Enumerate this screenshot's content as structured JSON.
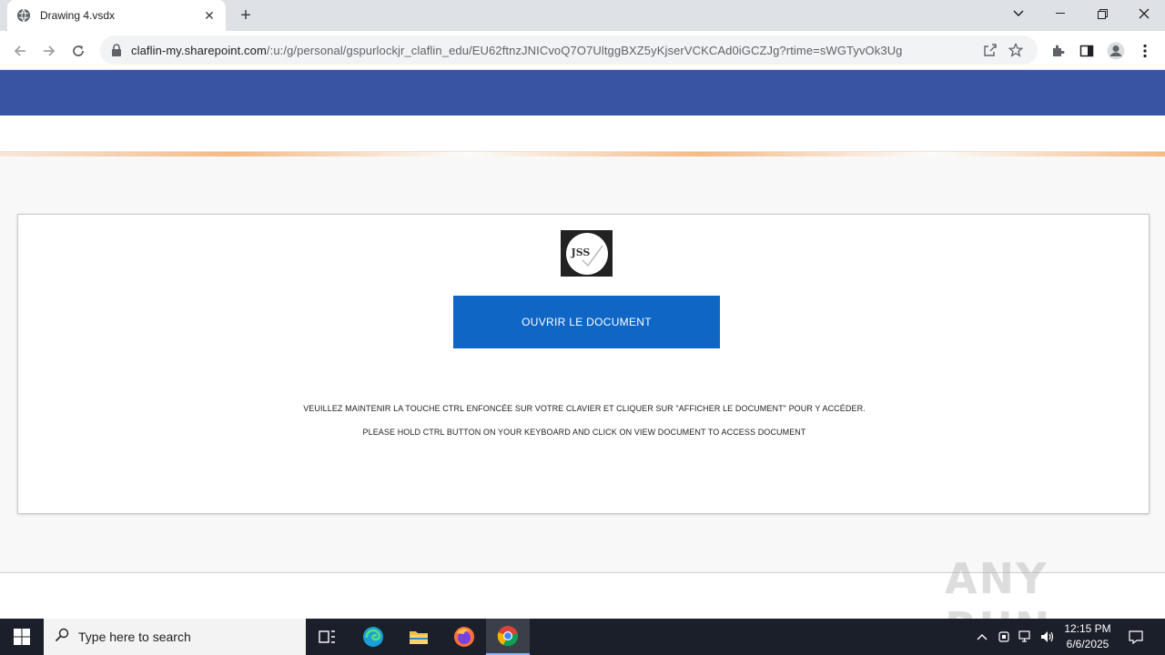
{
  "browser": {
    "tab_title": "Drawing 4.vsdx",
    "url_host": "claflin-my.sharepoint.com",
    "url_path": "/:u:/g/personal/gspurlockjr_claflin_edu/EU62ftnzJNICvoQ7O7UltggBXZ5yKjserVCKCAd0iGCZJg?rtime=sWGTyvOk3Ug"
  },
  "page": {
    "logo_text": "JSS",
    "open_button_label": "OUVRIR LE DOCUMENT",
    "message_fr": "VEUILLEZ MAINTENIR LA TOUCHE CTRL ENFONCÉE SUR VOTRE CLAVIER ET CLIQUER SUR \"AFFICHER LE DOCUMENT\" POUR Y ACCÉDER.",
    "message_en": "PLEASE HOLD CTRL BUTTON ON YOUR KEYBOARD AND CLICK ON VIEW DOCUMENT TO ACCESS DOCUMENT",
    "watermark": "ANY RUN"
  },
  "taskbar": {
    "search_placeholder": "Type here to search",
    "time": "12:15 PM",
    "date": "6/6/2025"
  },
  "colors": {
    "header_blue": "#3a54a4",
    "button_blue": "#0f66c4"
  }
}
